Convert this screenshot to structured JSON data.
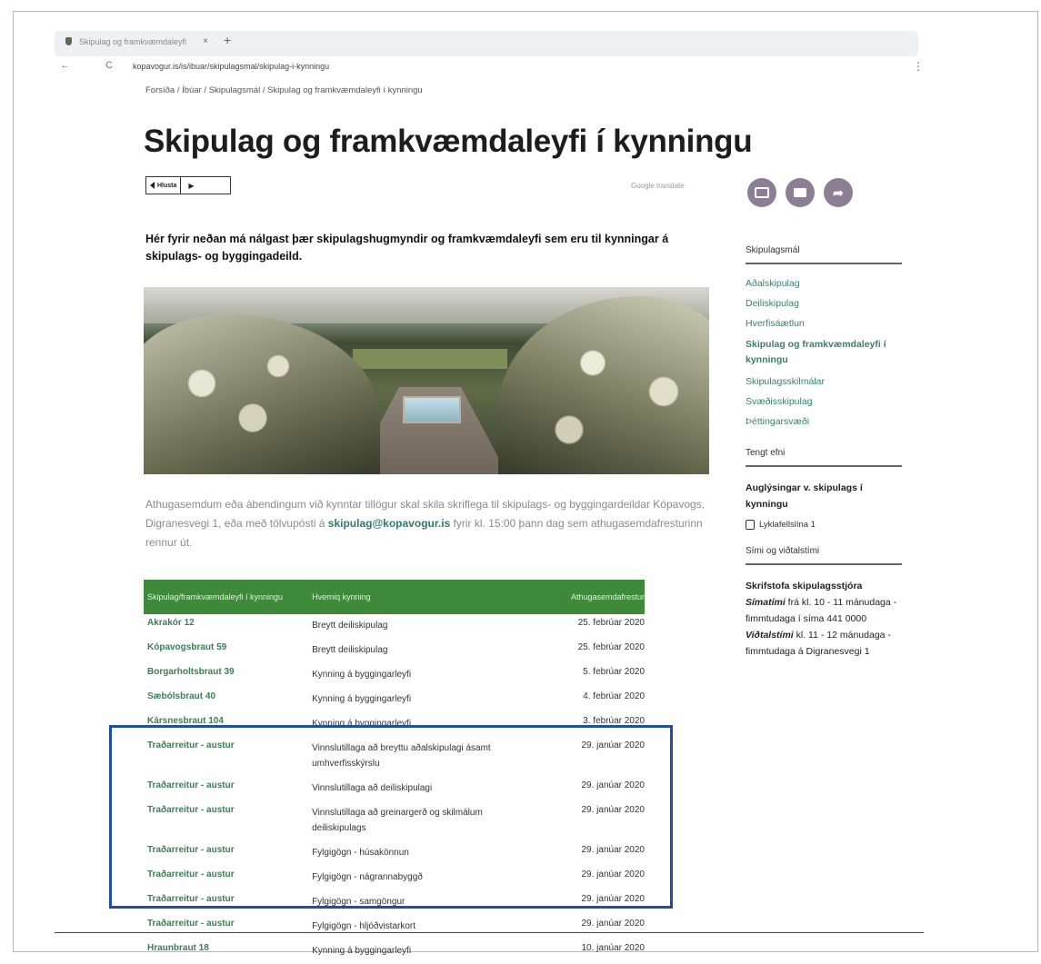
{
  "browser": {
    "tab_title": "Skipulag og framkvæmdaleyfi",
    "url": "kopavogur.is/is/ibuar/skipulagsmal/skipulag-i-kynningu",
    "back_icon": "←",
    "reload_icon": "C",
    "menu_icon": "⋮"
  },
  "breadcrumb": "Forsíða / Íbúar / Skipulagsmál / Skipulag og framkvæmdaleyfi í kynningu",
  "page": {
    "title": "Skipulag og framkvæmdaleyfi í kynningu",
    "listen_label": "Hlusta",
    "google_translate": "Google translate",
    "intro": "Hér fyrir neðan má nálgast þær skipulagshugmyndir og framkvæmdaleyfi sem eru til kynningar á skipulags- og byggingadeild.",
    "note_before": "Athugasemdum eða ábendingum við kynntar tillögur skal skila skriflega til skipulags- og byggingardeildar Kópavogs, Digranesvegi 1, eða með tölvupósti á ",
    "note_email": "skipulag@kopavogur.is",
    "note_after": " fyrir kl. 15:00 þann dag sem athugasemdafresturinn rennur út."
  },
  "table": {
    "headers": [
      "Skipulag/framkvæmdaleyfi í kynningu",
      "Hverniq kynning",
      "Athugasemdafrestur"
    ],
    "rows": [
      {
        "name": "Akrakór 12",
        "type": "Breytt deiliskipulag",
        "deadline": "25. febrúar 2020"
      },
      {
        "name": "Kópavogsbraut 59",
        "type": "Breytt deiliskipulag",
        "deadline": "25. febrúar 2020"
      },
      {
        "name": "Borgarholtsbraut 39",
        "type": "Kynning á byggingarleyfi",
        "deadline": "5. febrúar 2020"
      },
      {
        "name": "Sæbólsbraut 40",
        "type": "Kynning á byggingarleyfi",
        "deadline": "4. febrúar 2020"
      },
      {
        "name": "Kársnesbraut 104",
        "type": "Kynning á byggingarleyfi",
        "deadline": "3. febrúar 2020"
      },
      {
        "name": "Traðarreitur - austur",
        "type": "Vinnslutillaga að breyttu aðalskipulagi ásamt umhverfisskýrslu",
        "deadline": "29. janúar 2020"
      },
      {
        "name": "Traðarreitur - austur",
        "type": "Vinnslutillaga að deiliskipulagi",
        "deadline": "29. janúar 2020"
      },
      {
        "name": "Traðarreitur - austur",
        "type": "Vinnslutillaga að greinargerð og skilmálum deiliskipulags",
        "deadline": "29. janúar 2020"
      },
      {
        "name": "Traðarreitur - austur",
        "type": "Fylgigögn - húsakönnun",
        "deadline": "29. janúar 2020"
      },
      {
        "name": "Traðarreitur - austur",
        "type": "Fylgigögn - nágrannabyggð",
        "deadline": "29. janúar 2020"
      },
      {
        "name": "Traðarreitur - austur",
        "type": "Fylgigögn - samgöngur",
        "deadline": "29. janúar 2020"
      },
      {
        "name": "Traðarreitur - austur",
        "type": "Fylgigögn - hljóðvistarkort",
        "deadline": "29. janúar 2020"
      },
      {
        "name": "Hraunbraut 18",
        "type": "Kynning á byggingarleyfi",
        "deadline": "10. janúar 2020"
      }
    ]
  },
  "sidebar": {
    "section_title": "Skipulagsmál",
    "links": [
      {
        "label": "Aðalskipulag"
      },
      {
        "label": "Deiliskipulag"
      },
      {
        "label": "Hverfisáætlun"
      },
      {
        "label": "Skipulag og framkvæmdaleyfi í kynningu"
      },
      {
        "label": "Skipulagsskilmálar"
      },
      {
        "label": "Svæðisskipulag"
      },
      {
        "label": "Þéttingarsvæði"
      }
    ],
    "related_title": "Tengt efni",
    "related_link": "Auglýsingar v. skipulags í kynningu",
    "related_sub": "Lyklafellslína 1",
    "contact_title": "Sími og viðtalstími",
    "contact_org": "Skrifstofa skipulagsstjóra",
    "contact_phone_label": "Símatími",
    "contact_phone_text": " frá kl. 10 - 11 mánudaga - fimmtudaga í síma 441 0000",
    "contact_visit_label": "Viðtalstími",
    "contact_visit_text": " kl. 11 - 12 mánudaga - fimmtudaga á Digranesvegi 1"
  },
  "icons": {
    "print": "print-icon",
    "email": "email-icon",
    "share": "share-icon"
  },
  "colors": {
    "table_header": "#3e8a3a",
    "link": "#3d7d6a",
    "action_button": "#8c7e95",
    "highlight_box": "#1f4fa0"
  }
}
